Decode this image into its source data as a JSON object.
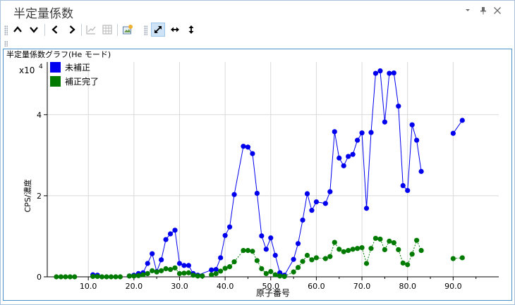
{
  "window": {
    "title": "半定量係数",
    "controls": [
      "dropdown-icon",
      "pin-icon",
      "close-icon"
    ]
  },
  "toolbar": {
    "buttons": [
      {
        "name": "move-up-button",
        "icon": "chevron-up-icon",
        "enabled": true
      },
      {
        "name": "move-down-button",
        "icon": "chevron-down-icon",
        "enabled": true
      },
      {
        "name": "previous-button",
        "icon": "chevron-left-icon",
        "enabled": true
      },
      {
        "name": "next-button",
        "icon": "chevron-right-icon",
        "enabled": true
      },
      {
        "name": "chart-view-button",
        "icon": "chart-icon",
        "enabled": false
      },
      {
        "name": "table-view-button",
        "icon": "table-icon",
        "enabled": false
      },
      {
        "name": "export-image-button",
        "icon": "image-export-icon",
        "enabled": true
      },
      {
        "name": "zoom-fit-button",
        "icon": "diagonal-arrows-icon",
        "enabled": true,
        "active": true
      },
      {
        "name": "zoom-horizontal-button",
        "icon": "horizontal-arrows-icon",
        "enabled": true
      },
      {
        "name": "zoom-vertical-button",
        "icon": "vertical-arrows-icon",
        "enabled": true
      }
    ]
  },
  "chart_data": {
    "type": "line",
    "title": "半定量係数グラフ(He モード)",
    "xlabel": "原子番号",
    "ylabel": "CPS/濃度",
    "y_multiplier": "x10",
    "y_exponent": "4",
    "xlim": [
      1,
      100
    ],
    "ylim": [
      0,
      5.3
    ],
    "xticks": [
      "10.0",
      "20.0",
      "30.0",
      "40.0",
      "50.0",
      "60.0",
      "70.0",
      "80.0",
      "90.0"
    ],
    "yticks": [
      "0",
      "2",
      "4"
    ],
    "grid": true,
    "legend_position": "top-left",
    "series": [
      {
        "name": "未補正",
        "color": "#0000ee",
        "x": [
          11,
          12,
          19,
          20,
          21,
          22,
          23,
          24,
          25,
          26,
          27,
          28,
          29,
          30,
          31,
          32,
          33,
          34,
          37,
          38,
          39,
          40,
          41,
          42,
          44,
          45,
          46,
          47,
          48,
          49,
          50,
          51,
          52,
          53,
          55,
          56,
          57,
          58,
          59,
          60,
          62,
          63,
          64,
          65,
          66,
          67,
          68,
          69,
          70,
          71,
          72,
          73,
          74,
          75,
          76,
          77,
          78,
          79,
          80,
          81,
          82,
          83,
          90,
          92
        ],
        "y": [
          0.05,
          0.04,
          0.02,
          0.04,
          0.08,
          0.1,
          0.33,
          0.57,
          0.13,
          0.42,
          0.92,
          1.06,
          1.15,
          0.33,
          0.28,
          0.28,
          0.08,
          0.04,
          0.17,
          0.18,
          0.47,
          1.02,
          1.23,
          2.03,
          3.22,
          3.2,
          3.04,
          2.06,
          1.01,
          0.68,
          0.96,
          0.53,
          0.1,
          0.04,
          0.43,
          0.82,
          1.4,
          2.05,
          1.64,
          1.85,
          1.81,
          2.1,
          3.58,
          2.93,
          2.74,
          2.97,
          3.02,
          3.37,
          3.55,
          1.69,
          3.56,
          5.02,
          5.08,
          3.82,
          5.02,
          5.03,
          4.21,
          2.25,
          2.13,
          3.75,
          3.37,
          2.6,
          3.54,
          3.86
        ],
        "breaks_after": [
          12,
          83
        ]
      },
      {
        "name": "補正完了",
        "color": "#007a00",
        "x": [
          3,
          4,
          5,
          6,
          7,
          11,
          12,
          13,
          14,
          15,
          16,
          17,
          19,
          20,
          21,
          22,
          23,
          24,
          25,
          26,
          27,
          28,
          29,
          30,
          31,
          32,
          33,
          34,
          35,
          37,
          38,
          39,
          40,
          41,
          42,
          44,
          45,
          46,
          47,
          48,
          49,
          50,
          51,
          52,
          53,
          55,
          56,
          57,
          58,
          59,
          60,
          62,
          63,
          64,
          65,
          66,
          67,
          68,
          69,
          70,
          71,
          72,
          73,
          74,
          75,
          76,
          77,
          78,
          79,
          80,
          81,
          82,
          83,
          90,
          92
        ],
        "y": [
          0,
          0,
          0,
          0,
          0,
          0.01,
          0.01,
          0,
          0,
          0,
          0,
          0,
          0.02,
          0.02,
          0.03,
          0.05,
          0.08,
          0.15,
          0.12,
          0.15,
          0.2,
          0.18,
          0.22,
          0.08,
          0.09,
          0.1,
          0.04,
          0.02,
          0.02,
          0.05,
          0.08,
          0.14,
          0.21,
          0.25,
          0.37,
          0.65,
          0.65,
          0.63,
          0.4,
          0.2,
          0.08,
          0.13,
          0.05,
          0.02,
          0.01,
          0.12,
          0.23,
          0.38,
          0.53,
          0.42,
          0.47,
          0.45,
          0.5,
          0.85,
          0.68,
          0.62,
          0.65,
          0.68,
          0.7,
          0.72,
          0.33,
          0.7,
          0.95,
          0.93,
          0.67,
          0.88,
          0.84,
          0.67,
          0.34,
          0.3,
          0.56,
          0.9,
          0.65,
          0.45,
          0.47
        ],
        "breaks_after": [
          7,
          17,
          35,
          83
        ]
      }
    ]
  }
}
